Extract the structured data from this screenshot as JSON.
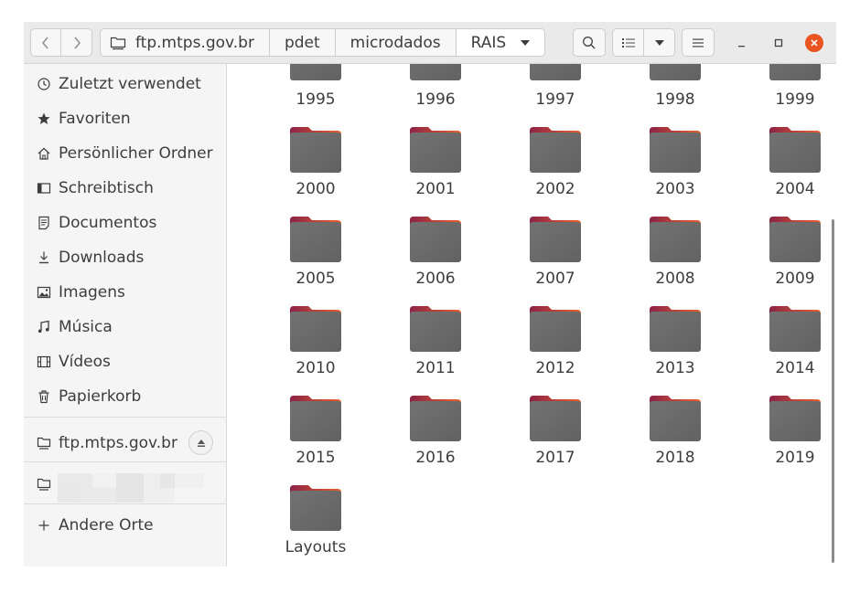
{
  "pathbar": {
    "crumbs": [
      "ftp.mtps.gov.br",
      "pdet",
      "microdados",
      "RAIS"
    ],
    "current_index": 3
  },
  "sidebar": {
    "items": [
      {
        "label": "Zuletzt verwendet",
        "icon": "clock-icon"
      },
      {
        "label": "Favoriten",
        "icon": "star-icon"
      },
      {
        "label": "Persönlicher Ordner",
        "icon": "home-icon"
      },
      {
        "label": "Schreibtisch",
        "icon": "desktop-icon"
      },
      {
        "label": "Documentos",
        "icon": "document-icon"
      },
      {
        "label": "Downloads",
        "icon": "download-icon"
      },
      {
        "label": "Imagens",
        "icon": "image-icon"
      },
      {
        "label": "Música",
        "icon": "music-icon"
      },
      {
        "label": "Vídeos",
        "icon": "video-icon"
      },
      {
        "label": "Papierkorb",
        "icon": "trash-icon"
      }
    ],
    "network_mount": {
      "label": "ftp.mtps.gov.br",
      "icon": "network-folder-icon"
    },
    "other_locations": {
      "label": "Andere Orte",
      "icon": "plus-icon"
    }
  },
  "folders": {
    "partial_row": [
      "1995",
      "1996",
      "1997",
      "1998",
      "1999"
    ],
    "items": [
      "2000",
      "2001",
      "2002",
      "2003",
      "2004",
      "2005",
      "2006",
      "2007",
      "2008",
      "2009",
      "2010",
      "2011",
      "2012",
      "2013",
      "2014",
      "2015",
      "2016",
      "2017",
      "2018",
      "2019",
      "Layouts"
    ]
  },
  "colors": {
    "accent": "#e95420",
    "folder_body": "#6e6e6e",
    "folder_tab_left": "#8c2346",
    "folder_tab_right": "#e8612d"
  }
}
